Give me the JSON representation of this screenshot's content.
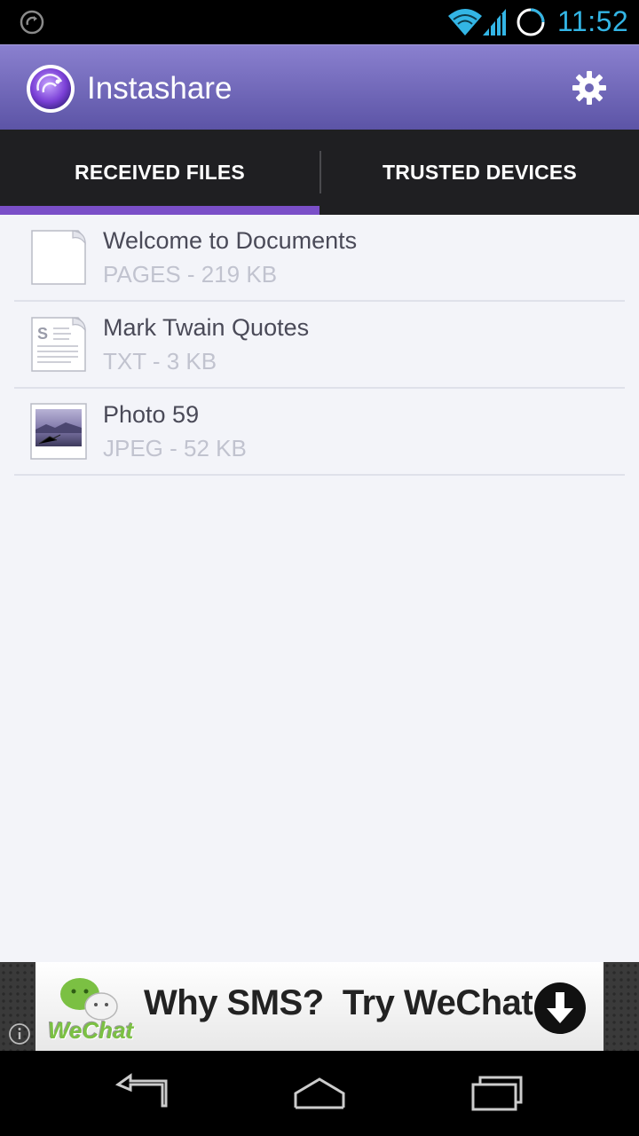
{
  "status_bar": {
    "time": "11:52",
    "icons": [
      "sync-icon",
      "wifi-icon",
      "signal-icon",
      "battery-icon"
    ]
  },
  "action_bar": {
    "title": "Instashare",
    "logo_icon": "instashare-logo-icon",
    "settings_icon": "gear-icon",
    "background_color": "#7068bb"
  },
  "tabs": [
    {
      "label": "RECEIVED FILES",
      "selected": true
    },
    {
      "label": "TRUSTED DEVICES",
      "selected": false
    }
  ],
  "accent_color": "#7a4fc8",
  "files": [
    {
      "name": "Welcome to Documents",
      "meta": "PAGES - 219 KB",
      "icon": "blank-document-icon"
    },
    {
      "name": "Mark Twain Quotes",
      "meta": "TXT - 3 KB",
      "icon": "text-document-icon"
    },
    {
      "name": "Photo 59",
      "meta": "JPEG - 52 KB",
      "icon": "photo-thumbnail-icon"
    }
  ],
  "ad": {
    "text": "Why SMS?  Try WeChat",
    "brand": "WeChat",
    "info_icon": "info-icon",
    "download_icon": "download-arrow-icon"
  },
  "nav_bar": {
    "buttons": [
      "back-icon",
      "home-icon",
      "recents-icon"
    ]
  }
}
